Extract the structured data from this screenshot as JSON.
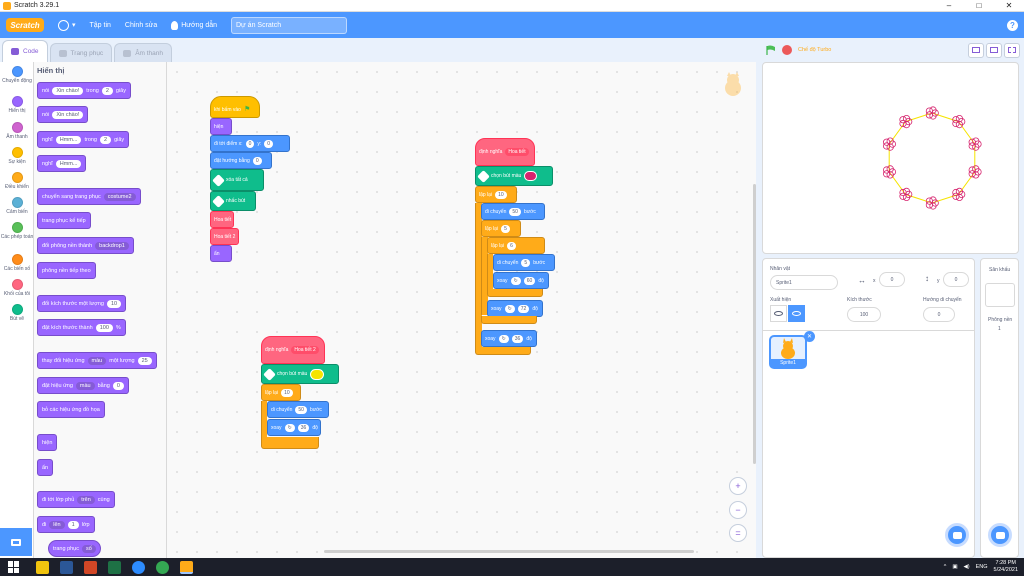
{
  "window": {
    "title": "Scratch 3.29.1",
    "buttons": [
      "–",
      "□",
      "✕"
    ]
  },
  "menubar": {
    "logo": "Scratch",
    "file": "Tập tin",
    "edit": "Chỉnh sửa",
    "tutorials": "Hướng dẫn",
    "project_title": "Dự án Scratch",
    "help": "?"
  },
  "tabs": {
    "code": "Code",
    "costumes": "Trang phục",
    "sounds": "Âm thanh"
  },
  "categories": [
    {
      "label": "Chuyển động",
      "color": "#4c97ff"
    },
    {
      "label": "Hiển thị",
      "color": "#9966ff"
    },
    {
      "label": "Âm thanh",
      "color": "#cf63cf"
    },
    {
      "label": "Sự kiện",
      "color": "#ffbf00"
    },
    {
      "label": "Điều khiển",
      "color": "#ffab19"
    },
    {
      "label": "Cảm biến",
      "color": "#5cb1d6"
    },
    {
      "label": "Các phép toán",
      "color": "#59c059"
    },
    {
      "label": "Các biến số",
      "color": "#ff8c1a"
    },
    {
      "label": "Khối của tôi",
      "color": "#ff6680"
    },
    {
      "label": "Bút vẽ",
      "color": "#0fbd8c"
    }
  ],
  "palette": {
    "heading": "Hiển thị",
    "say_for": {
      "verb": "nói",
      "text": "Xin chào!",
      "mid": "trong",
      "secs": "2",
      "unit": "giây"
    },
    "say": {
      "verb": "nói",
      "text": "Xin chào!"
    },
    "think_for": {
      "verb": "nghĩ",
      "text": "Hmm...",
      "mid": "trong",
      "secs": "2",
      "unit": "giây"
    },
    "think": {
      "verb": "nghĩ",
      "text": "Hmm..."
    },
    "switch_costume": {
      "text": "chuyển sang trang phục",
      "value": "costume2"
    },
    "next_costume": "trang phục kế tiếp",
    "switch_backdrop": {
      "text": "đổi phông nền thành",
      "value": "backdrop1"
    },
    "next_backdrop": "phông nền tiếp theo",
    "change_size": {
      "text": "đổi kích thước một lượng",
      "value": "10"
    },
    "set_size": {
      "text": "đặt kích thước thành",
      "value": "100",
      "unit": "%"
    },
    "change_effect": {
      "text": "thay đổi hiệu ứng",
      "effect": "màu",
      "mid": "một lượng",
      "value": "25"
    },
    "set_effect": {
      "text": "đặt hiệu ứng",
      "effect": "màu",
      "mid": "bằng",
      "value": "0"
    },
    "clear_effects": "bỏ các hiệu ứng đồ họa",
    "show": "hiện",
    "hide": "ẩn",
    "go_to_layer": {
      "text": "đi tới lớp phủ",
      "value": "trên",
      "tail": "cùng"
    },
    "go_layers": {
      "text": "đi",
      "value": "lên",
      "num": "1",
      "tail": "lớp"
    },
    "costume_reporter": {
      "text": "trang phục",
      "value": "số"
    }
  },
  "script1": {
    "hat": "khi bấm vào",
    "hide": "hiện",
    "goto": {
      "text": "đi tới điểm x:",
      "x": "0",
      "ylab": "y:",
      "y": "0"
    },
    "point": {
      "text": "đặt hướng bằng",
      "value": "0"
    },
    "erase_all": "xóa tất cả",
    "pen_up": "nhấc bút",
    "call1": "Hoa tiết",
    "call2": "Hoa tiết 2",
    "hide2": "ẩn"
  },
  "script2": {
    "define": "định nghĩa",
    "name": "Hoa tiết",
    "pen_color": "chọn bút màu",
    "pen_color_value": "#d6246e",
    "repeat1": {
      "text": "lặp lại",
      "value": "10"
    },
    "move1": {
      "text": "đi chuyển",
      "value": "50",
      "unit": "bước"
    },
    "repeat2": {
      "text": "lặp lại",
      "value": "5"
    },
    "repeat3": {
      "text": "lặp lại",
      "value": "6"
    },
    "move2": {
      "text": "di chuyển",
      "value": "5",
      "unit": "bước"
    },
    "turn1": {
      "text": "xoay",
      "value": "60",
      "unit": "độ"
    },
    "turn2": {
      "text": "xoay",
      "value": "72",
      "unit": "độ"
    },
    "turn3": {
      "text": "xoay",
      "value": "36",
      "unit": "độ"
    }
  },
  "script3": {
    "define": "định nghĩa",
    "name": "Hoa tiết 2",
    "pen_color": "chọn bút màu",
    "pen_color_value": "#f5e400",
    "repeat": {
      "text": "lặp lại",
      "value": "10"
    },
    "move": {
      "text": "di chuyển",
      "value": "50",
      "unit": "bước"
    },
    "turn": {
      "text": "xoay",
      "value": "36",
      "unit": "độ"
    }
  },
  "zoom": {
    "in": "+",
    "out": "−",
    "reset": "="
  },
  "stage": {
    "turbo": "Chế độ Turbo"
  },
  "sprite_info": {
    "sprite_label": "Nhân vật",
    "sprite_name": "Sprite1",
    "x_value": "0",
    "y_value": "0",
    "show_label": "Xuất hiện",
    "size_label": "Kích thước",
    "size_value": "100",
    "direction_label": "Hướng di chuyển",
    "direction_value": "0",
    "tile_label": "Sprite1"
  },
  "backdrop_pane": {
    "heading": "Sân khấu",
    "backdrops_label": "Phông nền",
    "count": "1"
  },
  "taskbar": {
    "lang": "ENG",
    "time": "7:28 PM",
    "date": "5/24/2021"
  },
  "colors": {
    "accent": "#4c97ff",
    "looks": "#9966ff",
    "control": "#ffab19",
    "motion": "#4c97ff",
    "pen": "#0fbd8c",
    "custom": "#ff6680"
  }
}
